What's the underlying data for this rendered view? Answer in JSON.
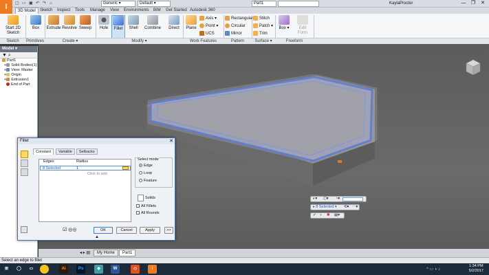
{
  "titlebar": {
    "app_icon_letter": "I",
    "material_combo": "Generic",
    "appearance_combo": "Default",
    "document_name": "Part1",
    "user_name": "KaylaProctor",
    "window_controls": [
      "—",
      "❐",
      "✕"
    ]
  },
  "ribbon_tabs": [
    "3D Model",
    "Sketch",
    "Inspect",
    "Tools",
    "Manage",
    "View",
    "Environments",
    "BIM",
    "Get Started",
    "Autodesk 360"
  ],
  "ribbon": {
    "start_sketch": "Start 2D Sketch",
    "box": "Box",
    "extrude": "Extrude",
    "revolve": "Revolve",
    "sweep": "Sweep",
    "hole": "Hole",
    "fillet": "Fillet",
    "shell": "Shell",
    "combine": "Combine",
    "direct": "Direct",
    "plane": "Plane",
    "axis": "Axis",
    "point": "Point",
    "ucs": "UCS",
    "rectangular": "Rectangular",
    "circular": "Circular",
    "mirror": "Mirror",
    "stitch": "Stitch",
    "patch": "Patch",
    "trim": "Trim",
    "freeform_box": "Box",
    "edit_form": "Edit Form",
    "panels": {
      "sketch": "Sketch",
      "primitives": "Primitives",
      "create": "Create ▾",
      "modify": "Modify ▾",
      "work_features": "Work Features",
      "pattern": "Pattern",
      "surface": "Surface ▾",
      "freeform": "Freeform"
    }
  },
  "browser": {
    "header": "Model ▾",
    "items": [
      "Part1",
      "Solid Bodies(1)",
      "View: Master",
      "Origin",
      "Extrusion1",
      "End of Part"
    ]
  },
  "fillet_dialog": {
    "title": "Fillet",
    "tabs": [
      "Constant",
      "Variable",
      "Setbacks"
    ],
    "col_edges": "Edges",
    "col_radius": "Radius",
    "row_edges": "8 Selected",
    "row_radius": "1",
    "click_to_add": "Click to add",
    "select_mode_label": "Select mode",
    "modes": [
      "Edge",
      "Loop",
      "Feature"
    ],
    "solids_label": "Solids",
    "all_fillets": "All Fillets",
    "all_rounds": "All Rounds",
    "ok": "OK",
    "cancel": "Cancel",
    "apply": "Apply",
    "expand": ">>"
  },
  "mini_toolbar": {
    "selected": "8 Selected"
  },
  "doc_tabs": [
    "My Home",
    "Part1"
  ],
  "status_text": "Select an edge to fillet",
  "taskbar": {
    "time": "1:34 PM",
    "date": "5/2/2017"
  },
  "colors": {
    "inventor_orange": "#f07a1c",
    "selection_blue": "#3f6ad8",
    "ribbon_bg": "#f4f6f8"
  }
}
